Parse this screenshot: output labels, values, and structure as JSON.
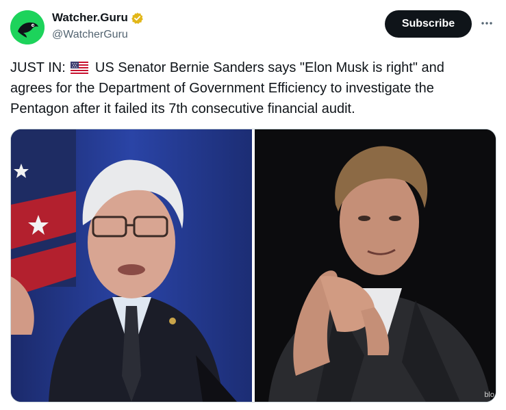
{
  "author": {
    "display_name": "Watcher.Guru",
    "handle": "@WatcherGuru",
    "verified_badge": "gold-verified-icon"
  },
  "subscribe_label": "Subscribe",
  "more_icon": "more-horizontal-icon",
  "tweet": {
    "prefix": "JUST IN:",
    "flag": "us-flag-emoji",
    "body": "US Senator Bernie Sanders says \"Elon Musk is right\" and agrees for the Department of Government Efficiency to investigate the Pentagon after it failed its 7th consecutive financial audit."
  },
  "media": {
    "watermark": "blo"
  },
  "colors": {
    "avatar_bg": "#1dd35b",
    "subscribe_bg": "#0f1419",
    "handle": "#536471",
    "verified": "#e2b719"
  }
}
